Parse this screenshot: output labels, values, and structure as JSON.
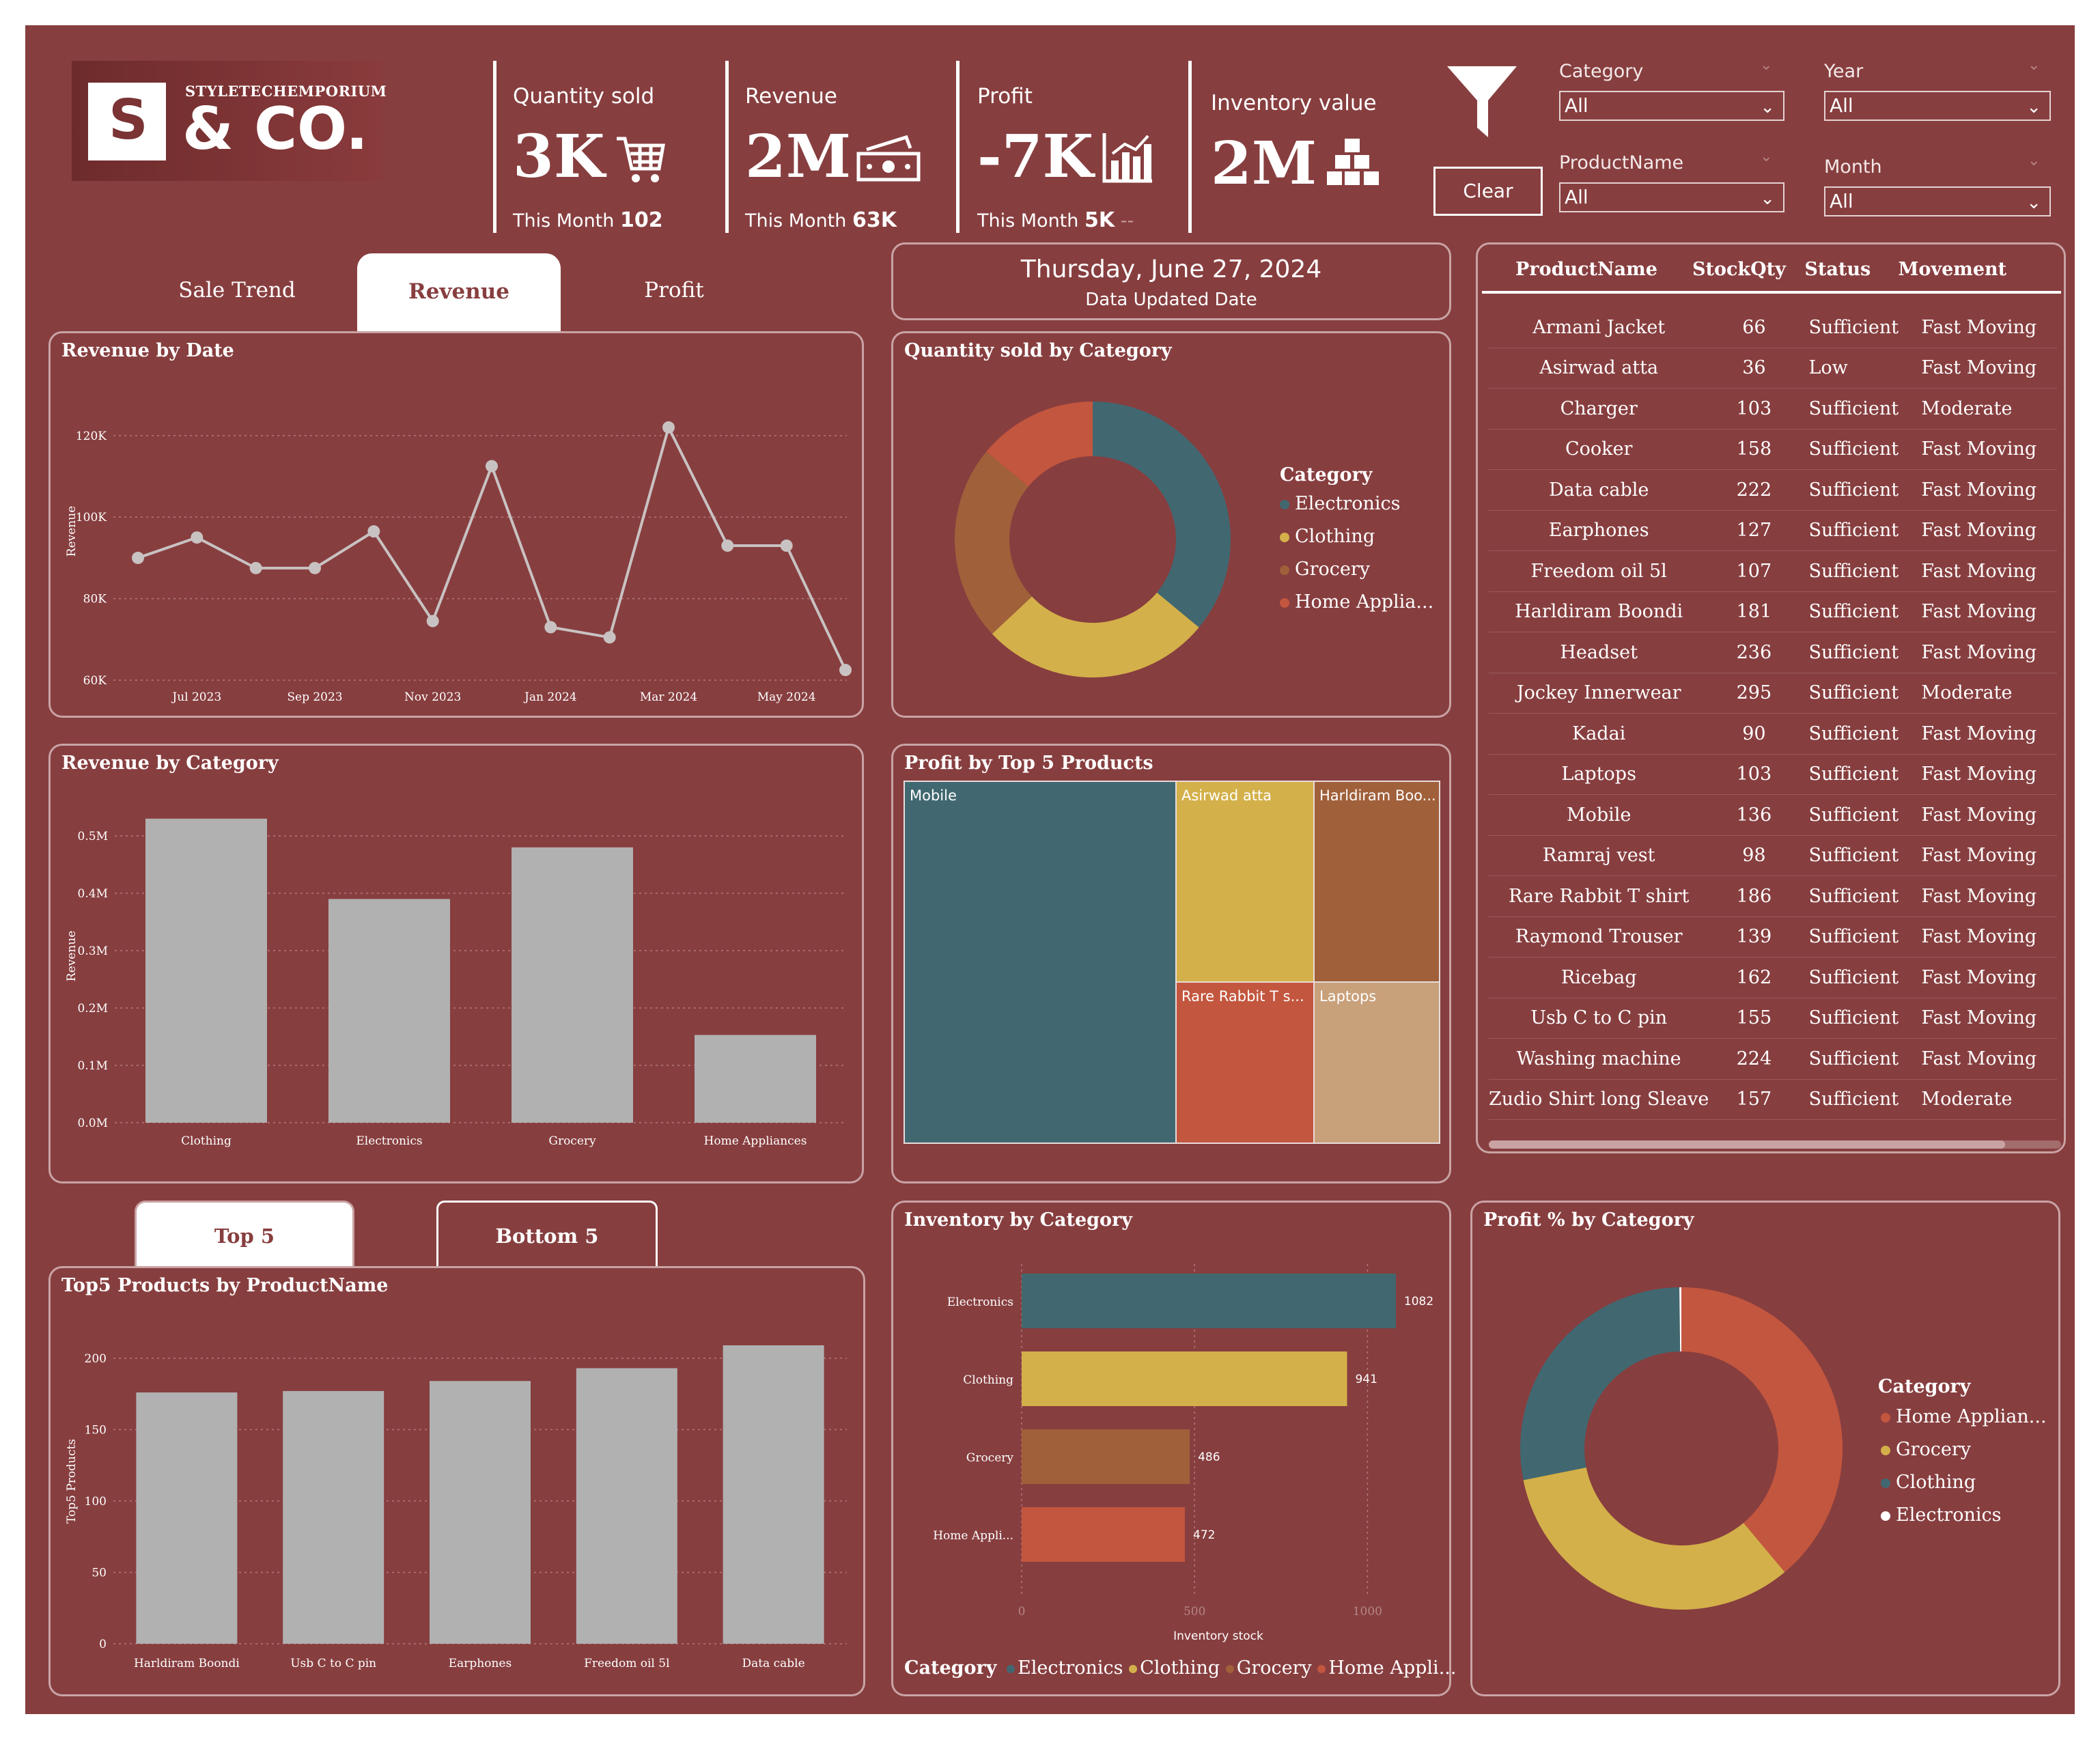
{
  "brand": {
    "small": "STYLETECHEMPORIUM",
    "big": "& CO.",
    "mark": "S"
  },
  "kpis": [
    {
      "label": "Quantity sold",
      "value": "3K",
      "sub_label": "This Month",
      "sub_value": "102",
      "icon": "cart-icon"
    },
    {
      "label": "Revenue",
      "value": "2M",
      "sub_label": "This Month",
      "sub_value": "63K",
      "icon": "cash-icon"
    },
    {
      "label": "Profit",
      "value": "-7K",
      "sub_label": "This Month",
      "sub_value": "5K",
      "sub_extra": "--",
      "icon": "chart-bar-icon"
    },
    {
      "label": "Inventory value",
      "value": "2M",
      "icon": "boxes-icon"
    }
  ],
  "filters": {
    "clear_label": "Clear",
    "category": {
      "label": "Category",
      "value": "All"
    },
    "year": {
      "label": "Year",
      "value": "All"
    },
    "product": {
      "label": "ProductName",
      "value": "All"
    },
    "month": {
      "label": "Month",
      "value": "All"
    }
  },
  "tabs": {
    "sale_trend": "Sale Trend",
    "revenue": "Revenue",
    "profit": "Profit",
    "active": "revenue"
  },
  "date_card": {
    "date": "Thursday, June 27, 2024",
    "caption": "Data Updated Date"
  },
  "colors": {
    "bg": "#873E3F",
    "teal": "#416870",
    "yellow": "#D3B04A",
    "brown": "#A0603A",
    "orange": "#C3563E",
    "tan": "#C8A07A",
    "grey": "#B1B1B1"
  },
  "revenue_by_date": {
    "title": "Revenue by Date",
    "chart_data": {
      "type": "line",
      "ylabel": "Revenue",
      "ylim": [
        60000,
        125000
      ],
      "yticks": [
        "60K",
        "80K",
        "100K",
        "120K"
      ],
      "yticks_values": [
        60000,
        80000,
        100000,
        120000
      ],
      "xtick_labels": [
        "Jul 2023",
        "Sep 2023",
        "Nov 2023",
        "Jan 2024",
        "Mar 2024",
        "May 2024"
      ],
      "x": [
        "Jun 2023",
        "Jul 2023",
        "Aug 2023",
        "Sep 2023",
        "Oct 2023",
        "Nov 2023",
        "Dec 2023",
        "Jan 2024",
        "Feb 2024",
        "Mar 2024",
        "Apr 2024",
        "May 2024",
        "Jun 2024"
      ],
      "values": [
        90000,
        95000,
        87500,
        87500,
        96500,
        74500,
        112500,
        73000,
        70500,
        122000,
        93000,
        93000,
        62500
      ]
    }
  },
  "qty_by_category": {
    "title": "Quantity sold by Category",
    "legend_title": "Category",
    "chart_data": {
      "type": "pie",
      "labels": [
        "Electronics",
        "Clothing",
        "Grocery",
        "Home Applia..."
      ],
      "values": [
        36,
        27,
        23,
        14
      ],
      "colors": [
        "#416870",
        "#D3B04A",
        "#A0603A",
        "#C3563E"
      ]
    }
  },
  "revenue_by_category": {
    "title": "Revenue by Category",
    "chart_data": {
      "type": "bar",
      "ylabel": "Revenue",
      "categories": [
        "Clothing",
        "Electronics",
        "Grocery",
        "Home Appliances"
      ],
      "values": [
        530000,
        390000,
        480000,
        153000
      ],
      "ylim": [
        0,
        550000
      ],
      "yticks": [
        "0.0M",
        "0.1M",
        "0.2M",
        "0.3M",
        "0.4M",
        "0.5M"
      ],
      "yticks_values": [
        0,
        100000,
        200000,
        300000,
        400000,
        500000
      ]
    }
  },
  "profit_top5": {
    "title": "Profit by Top 5 Products",
    "chart_data": {
      "type": "treemap",
      "labels": [
        "Mobile",
        "Asirwad atta",
        "Harldiram Boo...",
        "Rare Rabbit T s...",
        "Laptops"
      ],
      "colors": [
        "#416870",
        "#D3B04A",
        "#A0603A",
        "#C3563E",
        "#C8A07A"
      ]
    }
  },
  "stock_table": {
    "headers": [
      "ProductName",
      "StockQty",
      "Status",
      "Movement"
    ],
    "rows": [
      [
        "Armani Jacket",
        "66",
        "Sufficient",
        "Fast Moving"
      ],
      [
        "Asirwad atta",
        "36",
        "Low",
        "Fast Moving"
      ],
      [
        "Charger",
        "103",
        "Sufficient",
        "Moderate"
      ],
      [
        "Cooker",
        "158",
        "Sufficient",
        "Fast Moving"
      ],
      [
        "Data cable",
        "222",
        "Sufficient",
        "Fast Moving"
      ],
      [
        "Earphones",
        "127",
        "Sufficient",
        "Fast Moving"
      ],
      [
        "Freedom oil 5l",
        "107",
        "Sufficient",
        "Fast Moving"
      ],
      [
        "Harldiram Boondi",
        "181",
        "Sufficient",
        "Fast Moving"
      ],
      [
        "Headset",
        "236",
        "Sufficient",
        "Fast Moving"
      ],
      [
        "Jockey Innerwear",
        "295",
        "Sufficient",
        "Moderate"
      ],
      [
        "Kadai",
        "90",
        "Sufficient",
        "Fast Moving"
      ],
      [
        "Laptops",
        "103",
        "Sufficient",
        "Fast Moving"
      ],
      [
        "Mobile",
        "136",
        "Sufficient",
        "Fast Moving"
      ],
      [
        "Ramraj vest",
        "98",
        "Sufficient",
        "Fast Moving"
      ],
      [
        "Rare Rabbit T shirt",
        "186",
        "Sufficient",
        "Fast Moving"
      ],
      [
        "Raymond Trouser",
        "139",
        "Sufficient",
        "Fast Moving"
      ],
      [
        "Ricebag",
        "162",
        "Sufficient",
        "Fast Moving"
      ],
      [
        "Usb C to C pin",
        "155",
        "Sufficient",
        "Fast Moving"
      ],
      [
        "Washing machine",
        "224",
        "Sufficient",
        "Fast Moving"
      ],
      [
        "Zudio Shirt long Sleave",
        "157",
        "Sufficient",
        "Moderate"
      ]
    ]
  },
  "top_bottom_tabs": {
    "top": "Top 5",
    "bottom": "Bottom 5"
  },
  "top5_products": {
    "title": "Top5 Products by ProductName",
    "chart_data": {
      "type": "bar",
      "ylabel": "Top5 Products",
      "categories": [
        "Harldiram Boondi",
        "Usb C to C pin",
        "Earphones",
        "Freedom oil 5l",
        "Data cable"
      ],
      "values": [
        176,
        177,
        184,
        193,
        209
      ],
      "ylim": [
        0,
        220
      ],
      "yticks": [
        "0",
        "50",
        "100",
        "150",
        "200"
      ],
      "yticks_values": [
        0,
        50,
        100,
        150,
        200
      ]
    }
  },
  "inventory_by_category": {
    "title": "Inventory by Category",
    "xlabel": "Inventory stock",
    "legend_title": "Category",
    "legend": [
      "Electronics",
      "Clothing",
      "Grocery",
      "Home Appli..."
    ],
    "chart_data": {
      "type": "bar",
      "orientation": "horizontal",
      "categories": [
        "Electronics",
        "Clothing",
        "Grocery",
        "Home Appli..."
      ],
      "values": [
        1082,
        941,
        486,
        472
      ],
      "value_labels": [
        "1082",
        "941",
        "486",
        "472"
      ],
      "xlim": [
        0,
        1100
      ],
      "xticks": [
        "0",
        "500",
        "1000"
      ],
      "xticks_values": [
        0,
        500,
        1000
      ],
      "colors": [
        "#416870",
        "#D3B04A",
        "#A0603A",
        "#C3563E"
      ]
    }
  },
  "profit_pct_by_category": {
    "title": "Profit % by Category",
    "legend_title": "Category",
    "chart_data": {
      "type": "pie",
      "labels": [
        "Home Applian...",
        "Grocery",
        "Clothing",
        "Electronics"
      ],
      "values": [
        39,
        33,
        28,
        0.2
      ],
      "colors": [
        "#C3563E",
        "#D3B04A",
        "#416870",
        "#FFFFFF"
      ]
    }
  }
}
